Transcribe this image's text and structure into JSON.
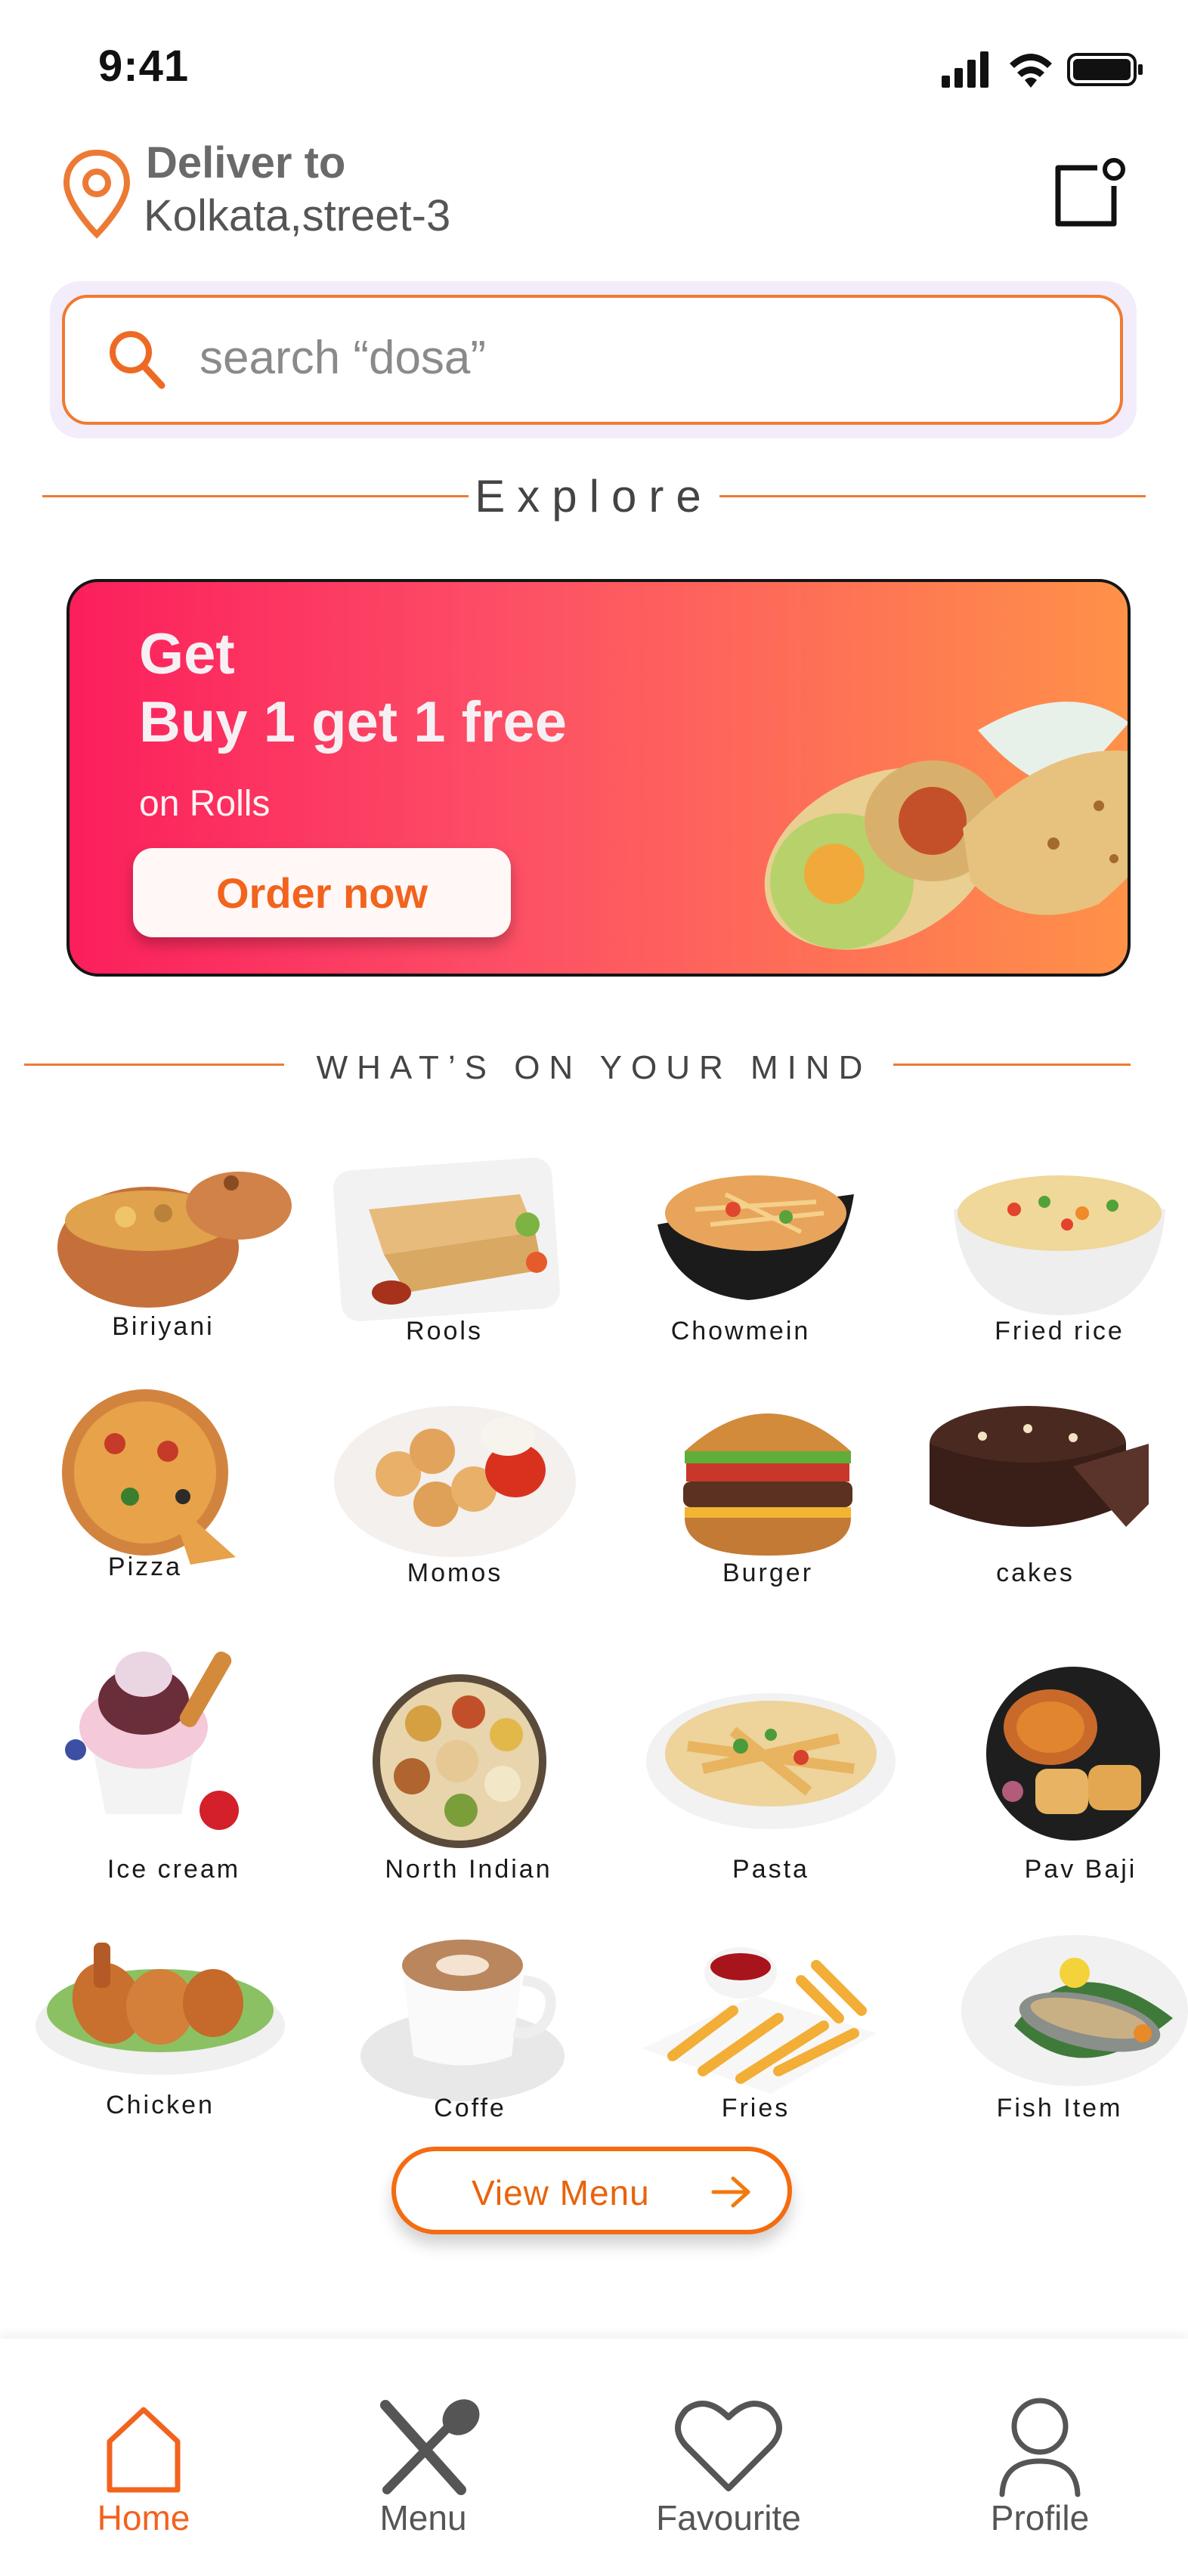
{
  "status_bar": {
    "time": "9:41"
  },
  "header": {
    "deliver_label": "Deliver to",
    "address": "Kolkata,street-3"
  },
  "search": {
    "placeholder": "search “dosa”"
  },
  "explore": {
    "title": "Explore"
  },
  "banner": {
    "line1": "Get",
    "line2": "Buy 1 get 1 free",
    "line3": "on Rolls",
    "cta": "Order now"
  },
  "mind": {
    "title": "WHAT’S ON YOUR MIND"
  },
  "categories": [
    {
      "label": "Biriyani",
      "icon": "biriyani-pot"
    },
    {
      "label": "Rools",
      "icon": "rolls-plate"
    },
    {
      "label": "Chowmein",
      "icon": "noodles-bowl"
    },
    {
      "label": "Fried rice",
      "icon": "fried-rice-bowl"
    },
    {
      "label": "Pizza",
      "icon": "pizza"
    },
    {
      "label": "Momos",
      "icon": "momos-plate"
    },
    {
      "label": "Burger",
      "icon": "burger"
    },
    {
      "label": "cakes",
      "icon": "chocolate-cake"
    },
    {
      "label": "Ice cream",
      "icon": "ice-cream-sundae"
    },
    {
      "label": "North Indian",
      "icon": "thali"
    },
    {
      "label": "Pasta",
      "icon": "pasta-plate"
    },
    {
      "label": "Pav Baji",
      "icon": "pav-bhaji"
    },
    {
      "label": "Chicken",
      "icon": "chicken-plate"
    },
    {
      "label": "Coffe",
      "icon": "coffee-cup"
    },
    {
      "label": "Fries",
      "icon": "fries"
    },
    {
      "label": "Fish Item",
      "icon": "fish-plate"
    }
  ],
  "view_menu": {
    "label": "View Menu"
  },
  "nav": [
    {
      "label": "Home",
      "icon": "home-icon",
      "active": true
    },
    {
      "label": "Menu",
      "icon": "fork-spoon-icon",
      "active": false
    },
    {
      "label": "Favourite",
      "icon": "heart-icon",
      "active": false
    },
    {
      "label": "Profile",
      "icon": "user-icon",
      "active": false
    }
  ],
  "colors": {
    "accent": "#f07a30",
    "active_nav": "#f2631e",
    "inactive_nav": "#555555"
  }
}
